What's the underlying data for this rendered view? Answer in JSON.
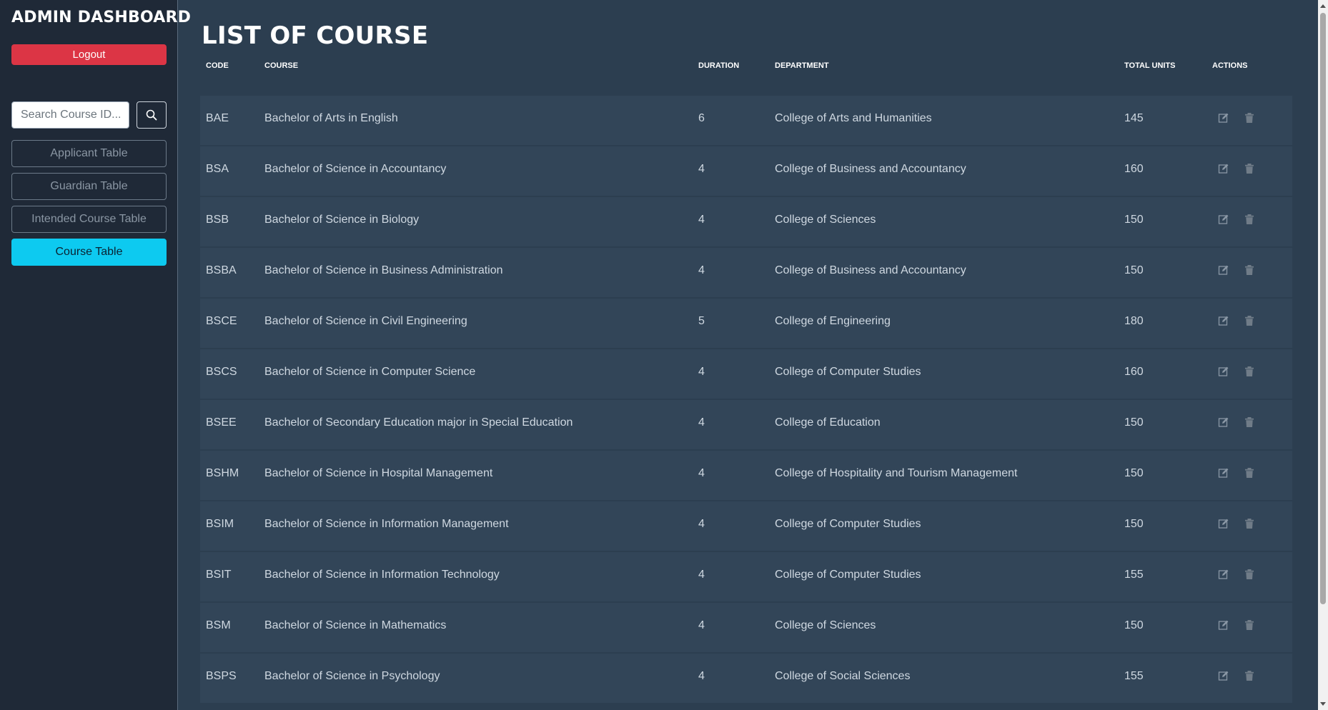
{
  "sidebar": {
    "title": "ADMIN DASHBOARD",
    "logout_label": "Logout",
    "search_placeholder": "Search Course ID...",
    "nav": [
      {
        "label": "Applicant Table",
        "active": false
      },
      {
        "label": "Guardian Table",
        "active": false
      },
      {
        "label": "Intended Course Table",
        "active": false
      },
      {
        "label": "Course Table",
        "active": true
      }
    ]
  },
  "main": {
    "title": "LIST OF COURSE",
    "columns": {
      "code": "CODE",
      "course": "COURSE",
      "duration": "DURATION",
      "department": "DEPARTMENT",
      "total_units": "TOTAL UNITS",
      "actions": "ACTIONS"
    },
    "rows": [
      {
        "code": "BAE",
        "course": "Bachelor of Arts in English",
        "duration": "6",
        "department": "College of Arts and Humanities",
        "units": "145"
      },
      {
        "code": "BSA",
        "course": "Bachelor of Science in Accountancy",
        "duration": "4",
        "department": "College of Business and Accountancy",
        "units": "160"
      },
      {
        "code": "BSB",
        "course": "Bachelor of Science in Biology",
        "duration": "4",
        "department": "College of Sciences",
        "units": "150"
      },
      {
        "code": "BSBA",
        "course": "Bachelor of Science in Business Administration",
        "duration": "4",
        "department": "College of Business and Accountancy",
        "units": "150"
      },
      {
        "code": "BSCE",
        "course": "Bachelor of Science in Civil Engineering",
        "duration": "5",
        "department": "College of Engineering",
        "units": "180"
      },
      {
        "code": "BSCS",
        "course": "Bachelor of Science in Computer Science",
        "duration": "4",
        "department": "College of Computer Studies",
        "units": "160"
      },
      {
        "code": "BSEE",
        "course": "Bachelor of Secondary Education major in Special Education",
        "duration": "4",
        "department": "College of Education",
        "units": "150"
      },
      {
        "code": "BSHM",
        "course": "Bachelor of Science in Hospital Management",
        "duration": "4",
        "department": "College of Hospitality and Tourism Management",
        "units": "150"
      },
      {
        "code": "BSIM",
        "course": "Bachelor of Science in Information Management",
        "duration": "4",
        "department": "College of Computer Studies",
        "units": "150"
      },
      {
        "code": "BSIT",
        "course": "Bachelor of Science in Information Technology",
        "duration": "4",
        "department": "College of Computer Studies",
        "units": "155"
      },
      {
        "code": "BSM",
        "course": "Bachelor of Science in Mathematics",
        "duration": "4",
        "department": "College of Sciences",
        "units": "150"
      },
      {
        "code": "BSPS",
        "course": "Bachelor of Science in Psychology",
        "duration": "4",
        "department": "College of Social Sciences",
        "units": "155"
      }
    ]
  },
  "icons": {
    "search": "search-icon",
    "edit": "edit-icon",
    "delete": "trash-icon"
  },
  "colors": {
    "background": "#2c3e50",
    "sidebar": "#1f2937",
    "logout": "#dc3545",
    "active_nav": "#0dcaf0",
    "row": "#324558"
  }
}
